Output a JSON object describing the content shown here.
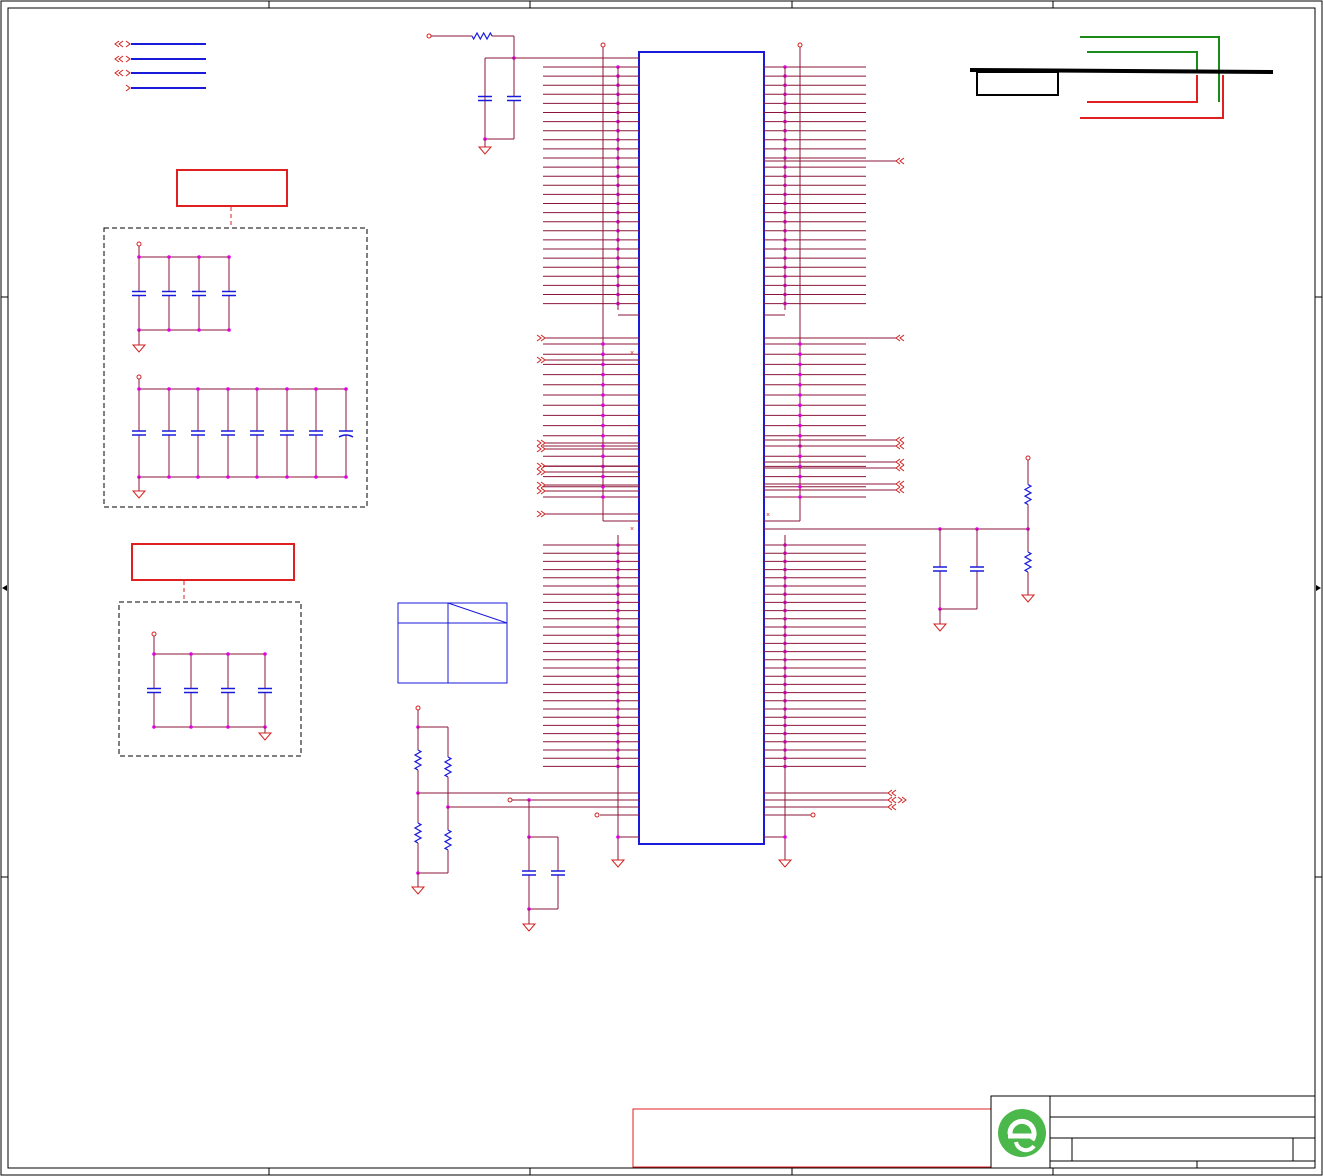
{
  "sheet": {
    "title": "",
    "colors": {
      "wire": "#8b1538",
      "junction": "#e000e0",
      "part": "#1a1adb",
      "power": "#d42020",
      "frame": "#000000",
      "accent_green": "#1a8a1a",
      "accent_red": "#e02020",
      "logo": "#4bb84b"
    },
    "icons": [
      "company-logo-icon",
      "ground-icon",
      "capacitor-icon",
      "resistor-icon",
      "off-page-connector-icon",
      "no-connect-icon"
    ]
  },
  "main_ic": {
    "left_pins_top_count": 27,
    "left_pins_mid_count": 16,
    "left_pins_bottom_count": 28,
    "right_pins_top_count": 27,
    "right_pins_mid_count": 16,
    "right_pins_bottom_count": 28
  }
}
